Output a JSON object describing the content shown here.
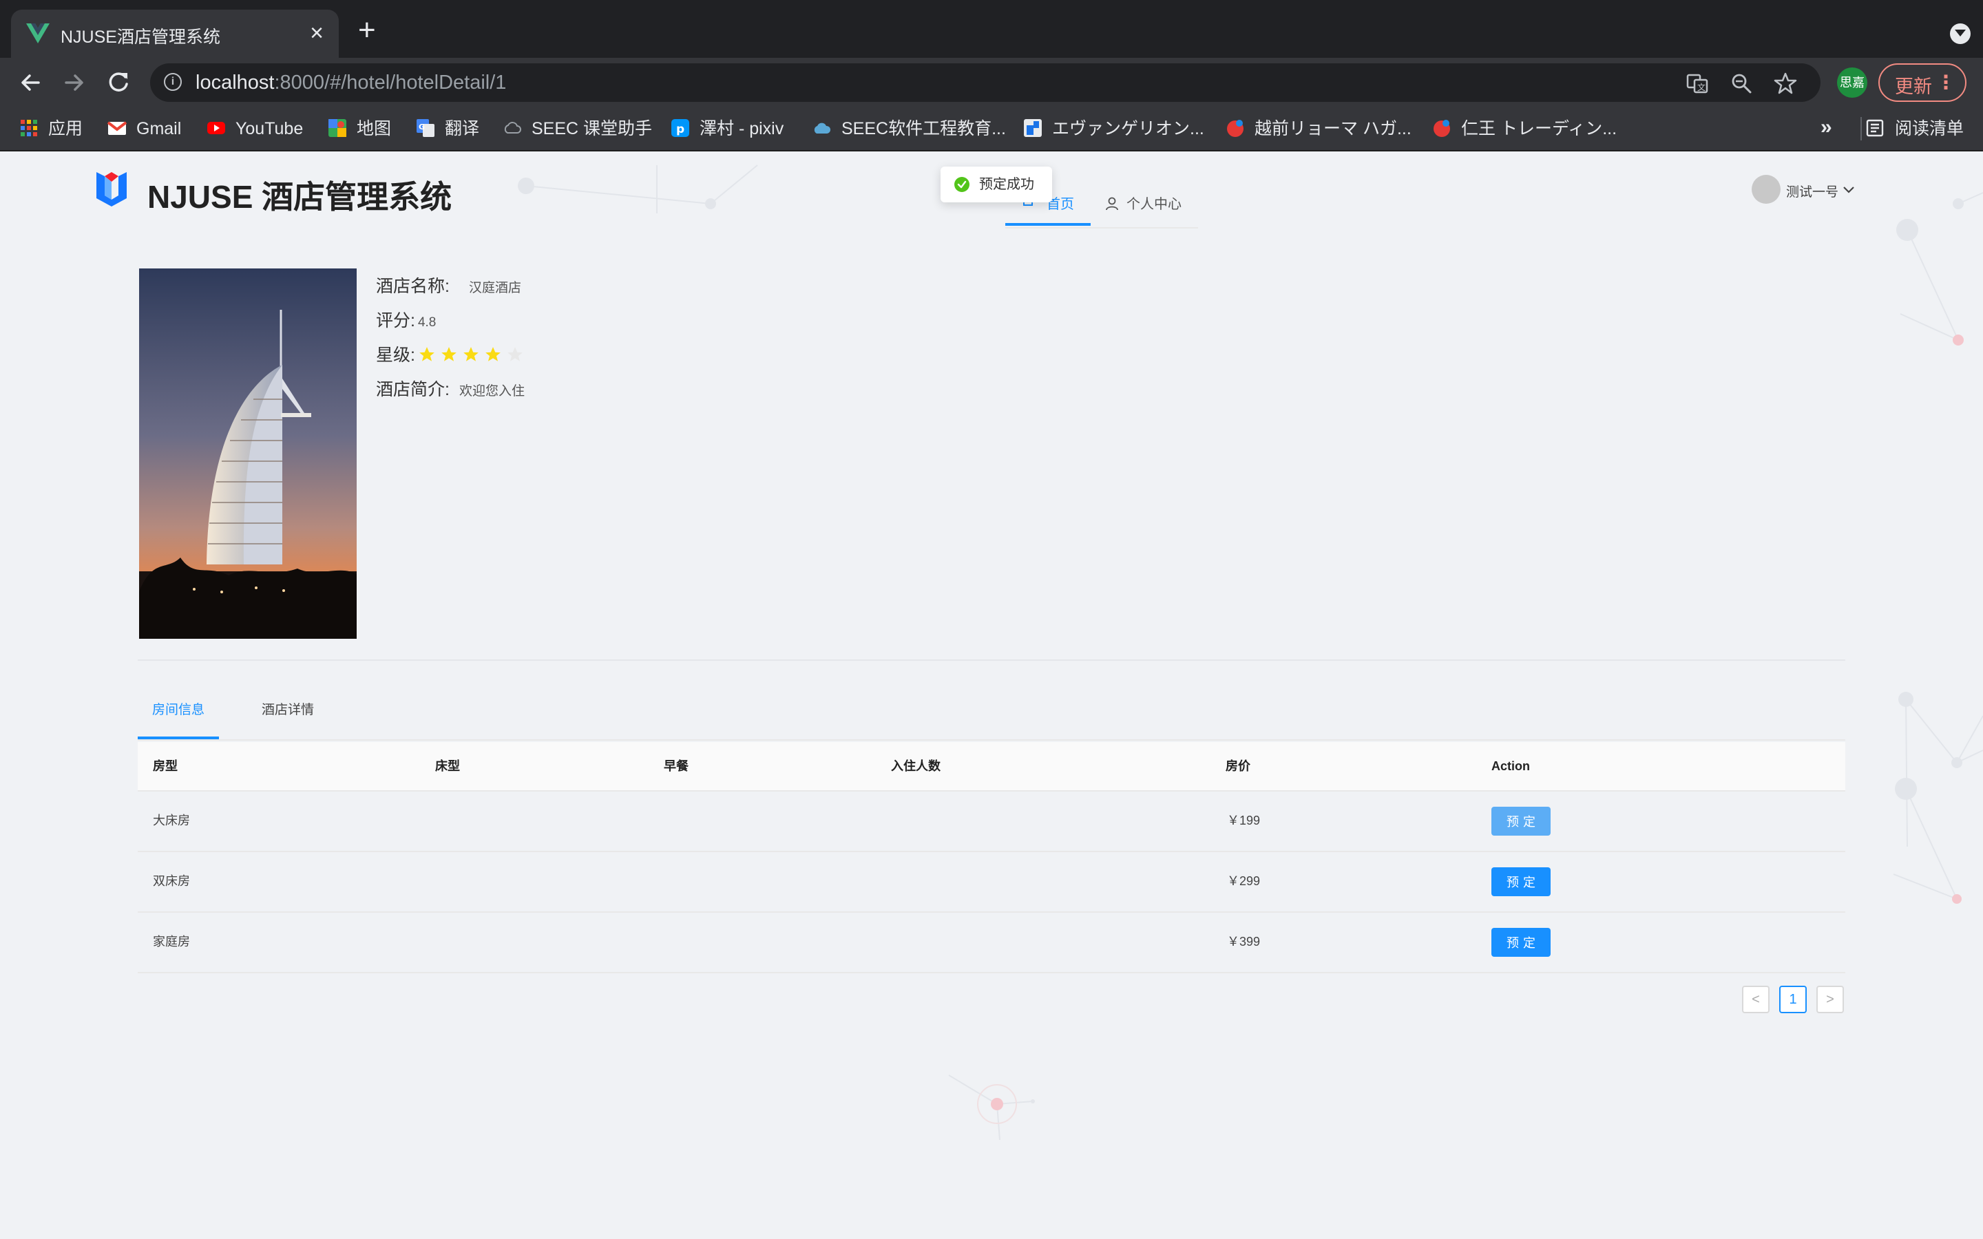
{
  "browser": {
    "tab_title": "NJUSE酒店管理系统",
    "url_host": "localhost",
    "url_path": ":8000/#/hotel/hotelDetail/1",
    "profile_label": "思嘉",
    "update_label": "更新",
    "bookmarks": [
      {
        "label": "应用",
        "icon": "apps-grid-icon"
      },
      {
        "label": "Gmail",
        "icon": "gmail-icon"
      },
      {
        "label": "YouTube",
        "icon": "youtube-icon"
      },
      {
        "label": "地图",
        "icon": "maps-icon"
      },
      {
        "label": "翻译",
        "icon": "translate-icon"
      },
      {
        "label": "SEEC 课堂助手",
        "icon": "cloud-icon"
      },
      {
        "label": "澤村 - pixiv",
        "icon": "pixiv-icon"
      },
      {
        "label": "SEEC软件工程教育...",
        "icon": "cloud-icon"
      },
      {
        "label": "エヴァンゲリオン...",
        "icon": "bookmark-site-icon"
      },
      {
        "label": "越前リョーマ ハガ...",
        "icon": "red-badge-icon"
      },
      {
        "label": "仁王 トレーディン...",
        "icon": "red-badge-icon"
      }
    ],
    "bookmarks_more": "»",
    "reading_list": "阅读清单"
  },
  "header": {
    "site_title": "NJUSE 酒店管理系统",
    "nav_home": "首页",
    "nav_user_center": "个人中心",
    "username": "测试一号",
    "message": "预定成功"
  },
  "hotel": {
    "name_label": "酒店名称:",
    "name_value": "汉庭酒店",
    "rate_label": "评分:",
    "rate_value": "4.8",
    "star_label": "星级:",
    "stars": 4,
    "stars_max": 5,
    "desc_label": "酒店简介:",
    "desc_value": "欢迎您入住"
  },
  "tabs": {
    "rooms": "房间信息",
    "detail": "酒店详情"
  },
  "table": {
    "columns": [
      "房型",
      "床型",
      "早餐",
      "入住人数",
      "房价",
      "Action"
    ],
    "rows": [
      {
        "room_type": "大床房",
        "bed_type": "",
        "breakfast": "",
        "people": "",
        "price": "￥199",
        "action": "预定"
      },
      {
        "room_type": "双床房",
        "bed_type": "",
        "breakfast": "",
        "people": "",
        "price": "￥299",
        "action": "预定"
      },
      {
        "room_type": "家庭房",
        "bed_type": "",
        "breakfast": "",
        "people": "",
        "price": "￥399",
        "action": "预定"
      }
    ]
  },
  "pagination": {
    "prev": "<",
    "current": "1",
    "next": ">"
  },
  "colors": {
    "primary": "#1890ff",
    "star": "#fadb14",
    "success": "#52c41a"
  }
}
